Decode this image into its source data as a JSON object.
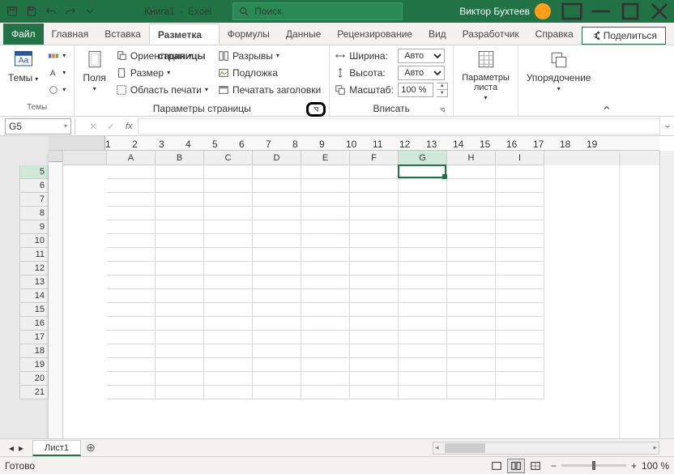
{
  "app": {
    "title": "Книга1",
    "suffix": "Excel",
    "user": "Виктор Бухтеев",
    "search_placeholder": "Поиск",
    "share": "Поделиться"
  },
  "tabs": {
    "file": "Файл",
    "home": "Главная",
    "insert": "Вставка",
    "layout": "Разметка страницы",
    "formulas": "Формулы",
    "data": "Данные",
    "review": "Рецензирование",
    "view": "Вид",
    "developer": "Разработчик",
    "help": "Справка"
  },
  "ribbon": {
    "themes": {
      "btn": "Темы",
      "label": "Темы"
    },
    "pagesetup": {
      "margins": "Поля",
      "orientation": "Ориентация",
      "size": "Размер",
      "printarea": "Область печати",
      "breaks": "Разрывы",
      "background": "Подложка",
      "printtitles": "Печатать заголовки",
      "label": "Параметры страницы"
    },
    "fit": {
      "width": "Ширина:",
      "height": "Высота:",
      "scale": "Масштаб:",
      "auto": "Авто",
      "scaleval": "100 %",
      "label": "Вписать"
    },
    "sheetopts": {
      "btn": "Параметры\nлиста",
      "label": ""
    },
    "arrange": {
      "btn": "Упорядочение",
      "label": ""
    }
  },
  "namebox": "G5",
  "columns": [
    "A",
    "B",
    "C",
    "D",
    "E",
    "F",
    "G",
    "H",
    "I"
  ],
  "rows": [
    "5",
    "6",
    "7",
    "8",
    "9",
    "10",
    "11",
    "12",
    "13",
    "14",
    "15",
    "16",
    "17",
    "18",
    "19",
    "20",
    "21"
  ],
  "sheet_tab": "Лист1",
  "status": "Готово",
  "zoom": "100 %",
  "ruler_ticks": [
    "1",
    "2",
    "3",
    "4",
    "5",
    "6",
    "7",
    "8",
    "9",
    "10",
    "11",
    "12",
    "13",
    "14",
    "15",
    "16",
    "17",
    "18",
    "19"
  ],
  "active": {
    "col": "G",
    "row": "5"
  }
}
